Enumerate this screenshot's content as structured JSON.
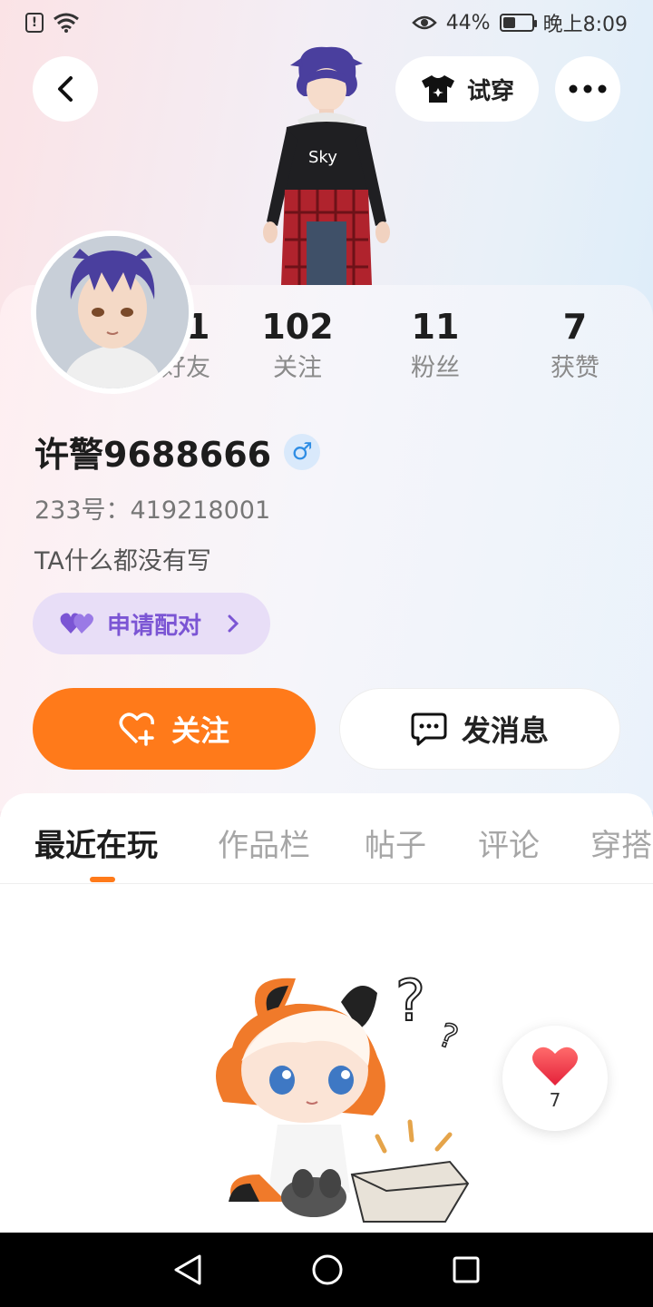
{
  "status_bar": {
    "battery_percent": "44%",
    "battery_level": 0.44,
    "time": "晚上8:09"
  },
  "header": {
    "try_on_label": "试穿"
  },
  "stats": [
    {
      "value": "41",
      "label": "好友"
    },
    {
      "value": "102",
      "label": "关注"
    },
    {
      "value": "11",
      "label": "粉丝"
    },
    {
      "value": "7",
      "label": "获赞"
    }
  ],
  "profile": {
    "username": "许警9688666",
    "gender_symbol": "♂",
    "uid": "233号：419218001",
    "bio": "TA什么都没有写",
    "pair_label": "申请配对"
  },
  "actions": {
    "follow_label": "关注",
    "message_label": "发消息"
  },
  "tabs": [
    {
      "label": "最近在玩",
      "active": true
    },
    {
      "label": "作品栏",
      "active": false
    },
    {
      "label": "帖子",
      "active": false
    },
    {
      "label": "评论",
      "active": false
    },
    {
      "label": "穿搭",
      "active": false
    }
  ],
  "like_fab": {
    "count": "7"
  },
  "colors": {
    "accent": "#ff7a1a",
    "pair_purple": "#7b55d4",
    "gender_blue": "#2f8de4"
  }
}
